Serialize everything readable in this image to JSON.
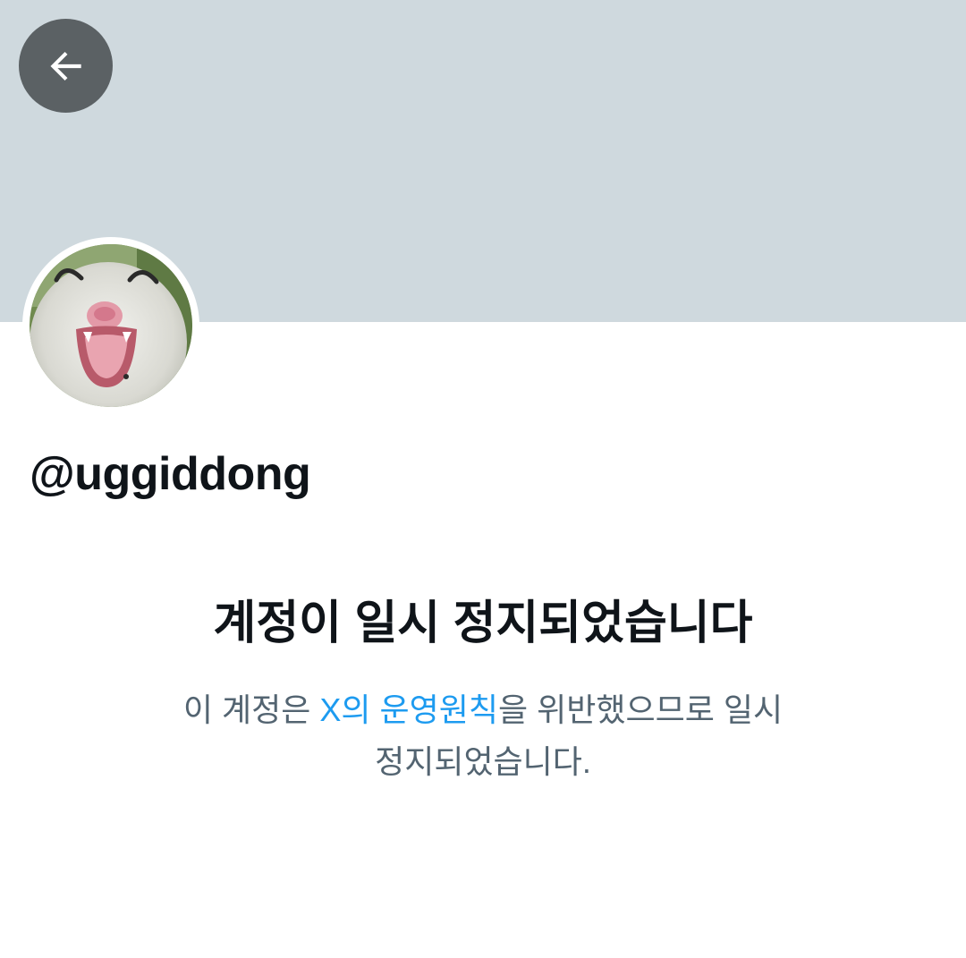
{
  "profile": {
    "handle": "@uggiddong",
    "back_icon": "arrow-left-icon",
    "avatar_description": "opossum photo"
  },
  "suspension": {
    "title": "계정이 일시 정지되었습니다",
    "desc_before_link": "이 계정은 ",
    "rules_link": "X의 운영원칙",
    "desc_after_link": "을 위반했으므로 일시 정지되었습니다."
  },
  "colors": {
    "banner": "#cfd9de",
    "back_button": "#5b6164",
    "link": "#1d9bf0",
    "secondary_text": "#536471",
    "primary_text": "#0f1419"
  }
}
